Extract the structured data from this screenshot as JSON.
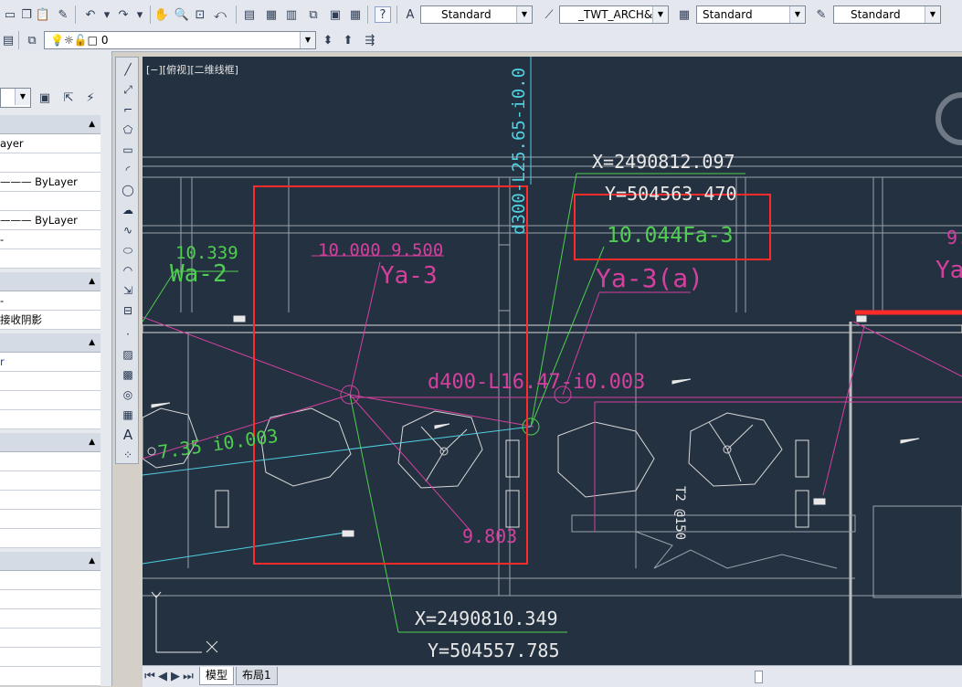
{
  "toolbar": {
    "text_style": "Standard",
    "dim_style": "_TWT_ARCH&",
    "table_style": "Standard",
    "multileader_style": "Standard",
    "layer_name": "0",
    "help_label": "?"
  },
  "properties": {
    "color_label": "ayer",
    "linetype_label": "ByLayer",
    "lineweight_label": "ByLayer",
    "shadow_label": "接收阴影",
    "layer_short": "r"
  },
  "canvas": {
    "viewport_label": "[−][俯视][二维线框]",
    "texts": {
      "pipe_label_1": "d300-L25.65-i0.0",
      "coord_x_top": "X=2490812.097",
      "coord_y_top": "Y=504563.470",
      "elev_label_1": "10.339",
      "node_wa2": "Wa-2",
      "elev_label_2": "10.000 9.500",
      "node_ya3": "Ya-3",
      "elev_fa3": "10.044Fa-3",
      "node_ya3a": "Ya-3(a)",
      "edge_label_9": "9.",
      "edge_label_ya": "Ya",
      "pipe_label_2": "d400-L16.47-i0.003",
      "pipe_label_3": "7.35 i0.003",
      "elev_label_3": "9.803",
      "vertical_note": "T2 @150",
      "coord_x_bottom": "X=2490810.349",
      "coord_y_bottom": "Y=504557.785"
    },
    "colors": {
      "background": "#243140",
      "magenta": "#d4409e",
      "green": "#4fcf4f",
      "cyan": "#4fd0e0",
      "white": "#e8e8e8",
      "red": "#ff2a2a"
    }
  },
  "layout_tabs": {
    "model": "模型",
    "layout1": "布局1"
  }
}
